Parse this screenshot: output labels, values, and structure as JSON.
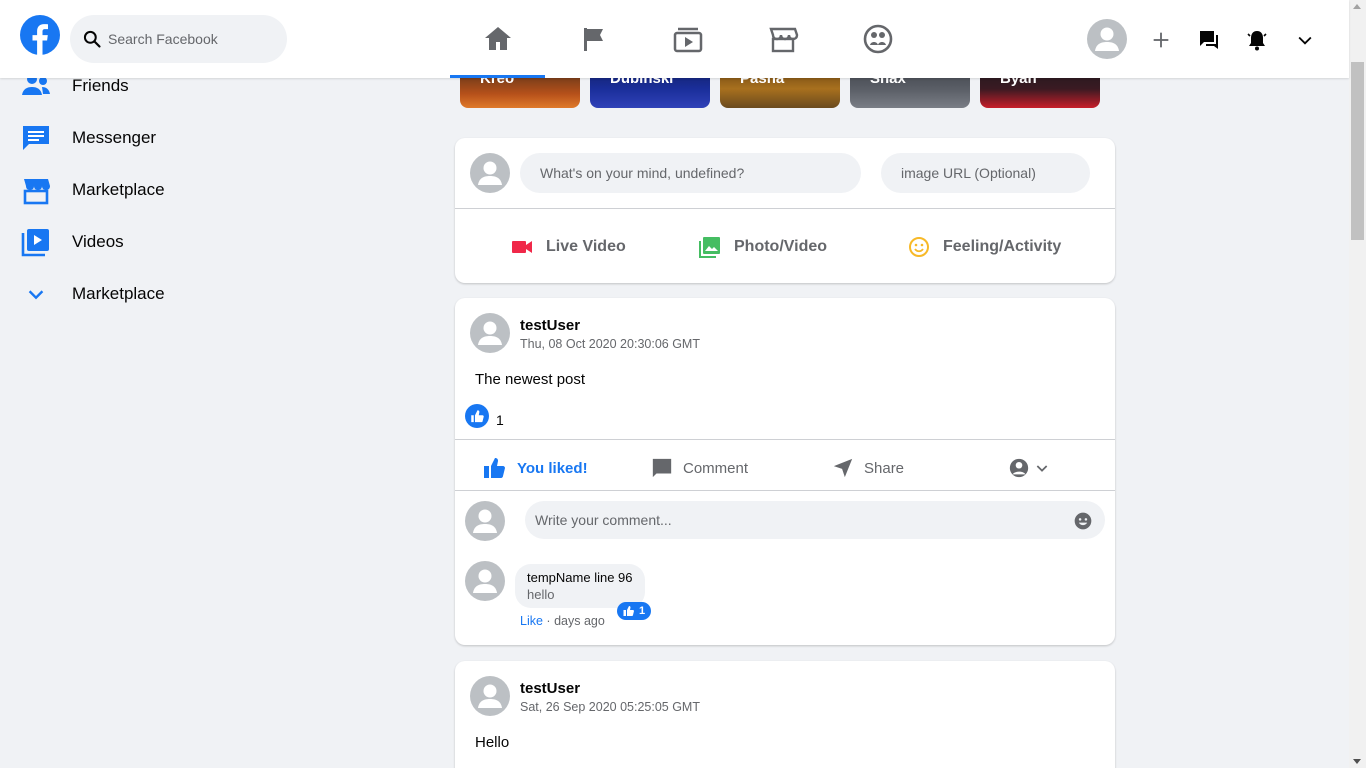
{
  "header": {
    "search_placeholder": "Search Facebook",
    "nav_tabs": [
      "home-icon",
      "flag-icon",
      "watch-icon",
      "marketplace-icon",
      "groups-icon"
    ],
    "active_tab": "home-icon",
    "brand_color": "#1877f2"
  },
  "sidebar": {
    "items": [
      {
        "label": "Friends",
        "icon": "friends-icon"
      },
      {
        "label": "Messenger",
        "icon": "messenger-icon"
      },
      {
        "label": "Marketplace",
        "icon": "marketplace-icon"
      },
      {
        "label": "Videos",
        "icon": "videos-icon"
      },
      {
        "label": "Marketplace",
        "icon": "chevron-down-icon"
      }
    ]
  },
  "stories": [
    {
      "name": "Kreo"
    },
    {
      "name": "Dubinski"
    },
    {
      "name": "Pasha"
    },
    {
      "name": "Shax"
    },
    {
      "name": "Byan"
    }
  ],
  "composer": {
    "mind_placeholder": "What's on your mind, undefined?",
    "image_placeholder": "image URL (Optional)",
    "live_video": "Live Video",
    "photo_video": "Photo/Video",
    "feeling": "Feeling/Activity"
  },
  "posts": [
    {
      "author": "testUser",
      "time": "Thu, 08 Oct 2020 20:30:06 GMT",
      "text": "The newest post",
      "like_count": "1",
      "liked_label": "You liked!",
      "comment_label": "Comment",
      "share_label": "Share",
      "comment_placeholder": "Write your comment...",
      "comments": [
        {
          "name": "tempName line 96",
          "text": "hello",
          "likes": "1",
          "like_label": "Like",
          "when": "days ago"
        }
      ]
    },
    {
      "author": "testUser",
      "time": "Sat, 26 Sep 2020 05:25:05 GMT",
      "text": "Hello"
    }
  ]
}
